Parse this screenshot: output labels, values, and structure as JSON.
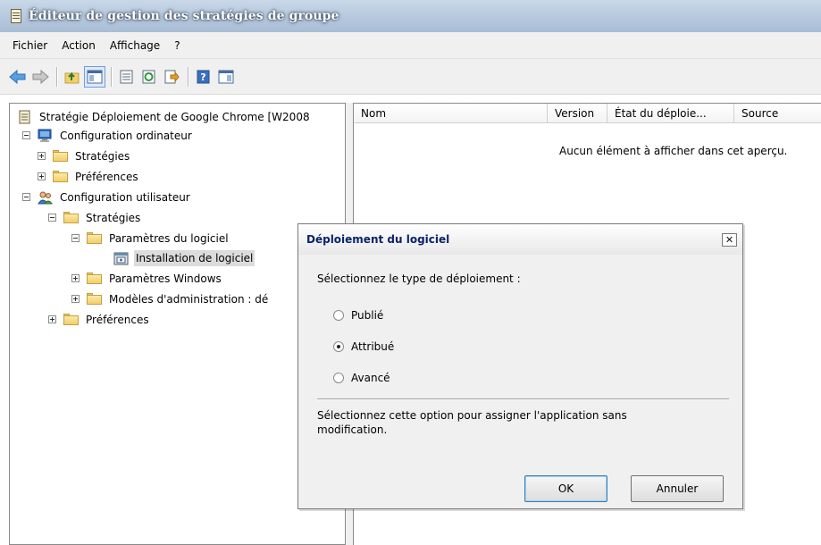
{
  "window": {
    "title": "Éditeur de gestion des stratégies de groupe"
  },
  "menu": {
    "items": [
      "Fichier",
      "Action",
      "Affichage",
      "?"
    ]
  },
  "toolbar": {
    "buttons": [
      "back-arrow-icon",
      "forward-arrow-icon",
      "up-folder-icon",
      "show-hide-tree-icon",
      "properties-icon",
      "refresh-icon",
      "export-list-icon",
      "help-icon",
      "show-hide-action-pane-icon"
    ]
  },
  "tree": {
    "root": "Stratégie Déploiement de Google Chrome [W2008",
    "computer_config": "Configuration ordinateur",
    "computer_strategies": "Stratégies",
    "computer_preferences": "Préférences",
    "user_config": "Configuration utilisateur",
    "user_strategies": "Stratégies",
    "software_settings": "Paramètres du logiciel",
    "software_install": "Installation de logiciel",
    "windows_settings": "Paramètres Windows",
    "admin_templates": "Modèles d'administration : dé",
    "user_preferences": "Préférences"
  },
  "list": {
    "columns": [
      "Nom",
      "Version",
      "État du déploie...",
      "Source"
    ],
    "empty_message": "Aucun élément à afficher dans cet aperçu."
  },
  "dialog": {
    "title": "Déploiement du logiciel",
    "close_label": "✕",
    "prompt": "Sélectionnez le type de déploiement :",
    "options": [
      {
        "label": "Publié",
        "checked": false
      },
      {
        "label": "Attribué",
        "checked": true
      },
      {
        "label": "Avancé",
        "checked": false
      }
    ],
    "description": "Sélectionnez cette option pour assigner l'application sans modification.",
    "ok_label": "OK",
    "cancel_label": "Annuler"
  }
}
